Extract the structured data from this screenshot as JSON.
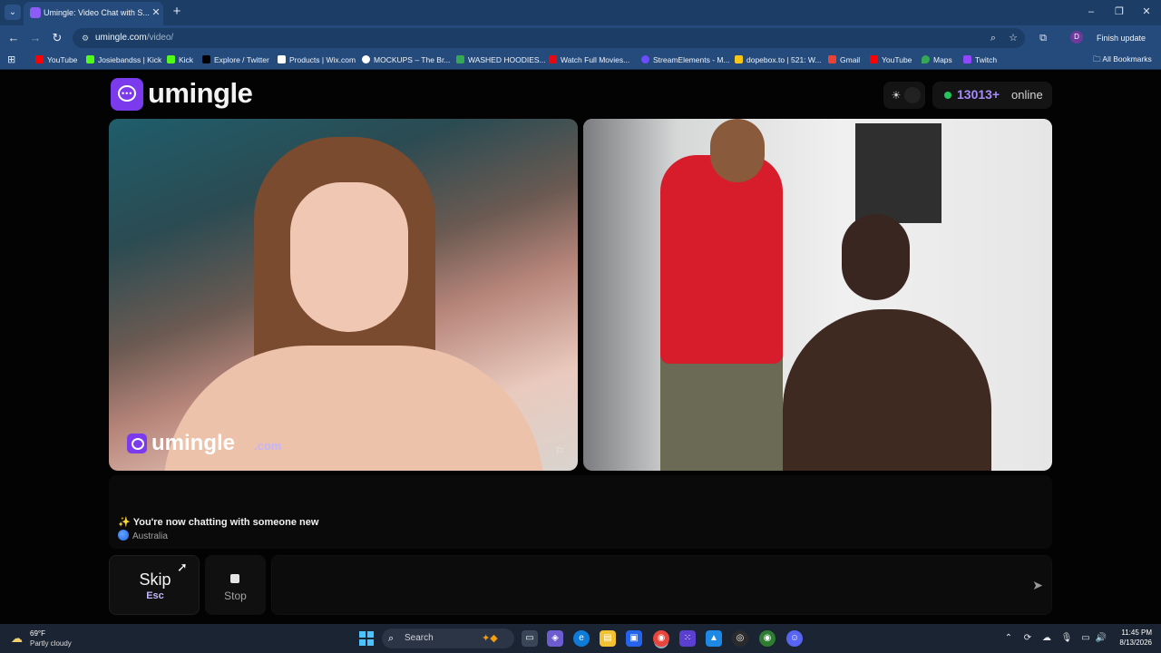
{
  "browser": {
    "tab_title": "Umingle: Video Chat with S...",
    "url_host": "umingle.com",
    "url_path": "/video/",
    "finish_update": "Finish update",
    "profile_initial": "D",
    "bookmarks": [
      {
        "label": "YouTube",
        "color": "#ff0000"
      },
      {
        "label": "Josiebandss | Kick",
        "color": "#53fc18"
      },
      {
        "label": "Kick",
        "color": "#53fc18"
      },
      {
        "label": "Explore / Twitter",
        "color": "#000000"
      },
      {
        "label": "Products | Wix.com",
        "color": "#ffffff"
      },
      {
        "label": "MOCKUPS – The Br...",
        "color": "#ffffff"
      },
      {
        "label": "WASHED HOODIES...",
        "color": "#34a853"
      },
      {
        "label": "Watch Full Movies...",
        "color": "#e50914"
      },
      {
        "label": "StreamElements - M...",
        "color": "#6b4cff"
      },
      {
        "label": "dopebox.to | 521: W...",
        "color": "#f5c518"
      },
      {
        "label": "Gmail",
        "color": "#ea4335"
      },
      {
        "label": "YouTube",
        "color": "#ff0000"
      },
      {
        "label": "Maps",
        "color": "#34a853"
      },
      {
        "label": "Twitch",
        "color": "#9146ff"
      }
    ],
    "all_bookmarks": "All Bookmarks"
  },
  "site": {
    "logo_text": "umingle",
    "online_count": "13013+",
    "online_label": "online",
    "watermark_text": "umingle",
    "watermark_tld": ".com"
  },
  "chat": {
    "status_message": "You're now chatting with someone new",
    "country": "Australia"
  },
  "controls": {
    "skip_label": "Skip",
    "skip_key": "Esc",
    "stop_label": "Stop",
    "message_placeholder": ""
  },
  "taskbar": {
    "temperature": "69°F",
    "weather": "Partly cloudy",
    "search_placeholder": "Search",
    "time": "11:45 PM",
    "date": "8/13/2026"
  }
}
